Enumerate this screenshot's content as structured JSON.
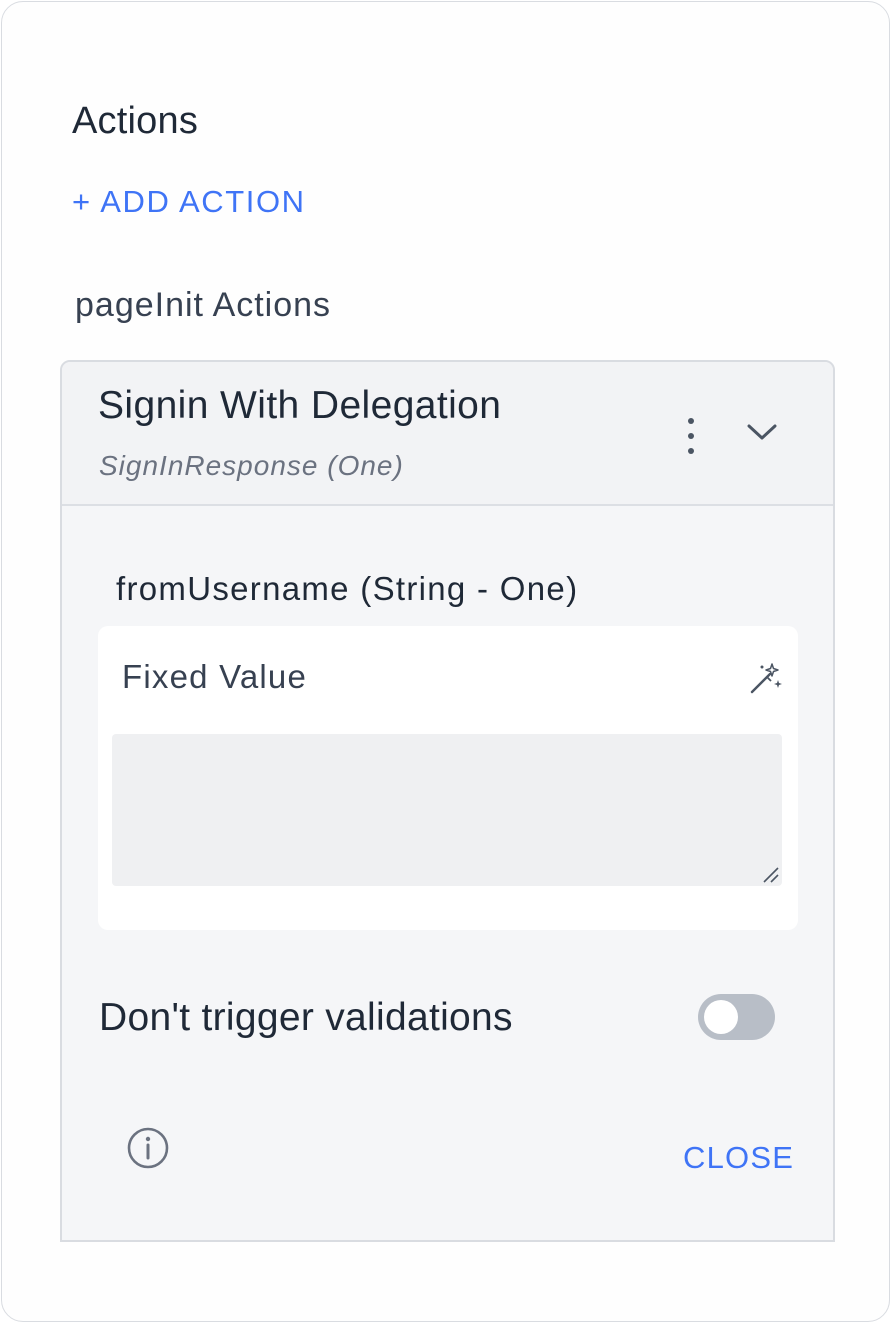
{
  "actions": {
    "title": "Actions",
    "add_action_label": "+ ADD ACTION",
    "page_init_title": "pageInit Actions"
  },
  "action_card": {
    "title": "Signin With Delegation",
    "subtitle": "SignInResponse (One)",
    "more_icon": "kebab-vertical-icon",
    "expand_icon": "chevron-down-icon",
    "parameter": {
      "label": "fromUsername (String - One)",
      "value_type": "Fixed Value",
      "value_type_icon": "magic-wand-icon",
      "value": ""
    },
    "toggle": {
      "label": "Don't trigger validations",
      "checked": false
    },
    "info_icon": "info-circle-icon",
    "close_label": "CLOSE"
  },
  "colors": {
    "accent": "#3f74f6",
    "text_primary": "#1f2937",
    "text_muted": "#6b7280",
    "card_background": "#f5f6f8",
    "toggle_off": "#b8bec7"
  }
}
